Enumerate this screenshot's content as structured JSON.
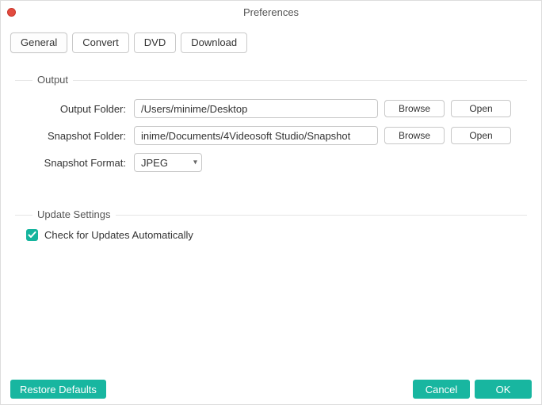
{
  "window": {
    "title": "Preferences"
  },
  "tabs": {
    "general": "General",
    "convert": "Convert",
    "dvd": "DVD",
    "download": "Download",
    "active": "general"
  },
  "output_group": {
    "legend": "Output",
    "output_folder_label": "Output Folder:",
    "output_folder_value": "/Users/minime/Desktop",
    "snapshot_folder_label": "Snapshot Folder:",
    "snapshot_folder_value": "inime/Documents/4Videosoft Studio/Snapshot",
    "snapshot_format_label": "Snapshot Format:",
    "snapshot_format_value": "JPEG",
    "browse_label": "Browse",
    "open_label": "Open"
  },
  "update_group": {
    "legend": "Update Settings",
    "check_updates_label": "Check for Updates Automatically",
    "check_updates_checked": true
  },
  "buttons": {
    "restore": "Restore Defaults",
    "cancel": "Cancel",
    "ok": "OK"
  }
}
